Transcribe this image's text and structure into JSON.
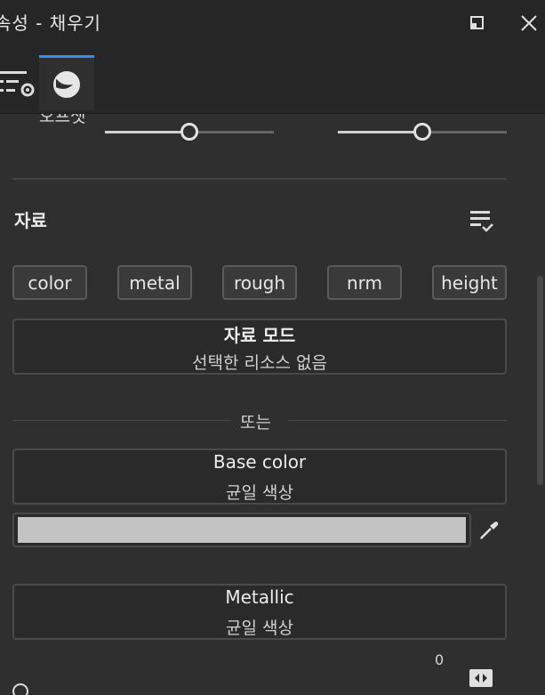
{
  "window": {
    "title": "속성 - 채우기"
  },
  "tabs": [
    {
      "icon": "settings-list-icon",
      "active": false
    },
    {
      "icon": "material-sphere-icon",
      "active": true
    }
  ],
  "panel": {
    "partial_label": "오프셋",
    "sliders": [
      {
        "value_fraction": 0.49
      },
      {
        "value_fraction": 0.49
      }
    ],
    "section": {
      "title": "자료",
      "menu_icon": "list-check-icon"
    },
    "channels": [
      "color",
      "metal",
      "rough",
      "nrm",
      "height"
    ],
    "material_mode": {
      "title": "자료 모드",
      "subtitle": "선택한 리소스 없음"
    },
    "or_label": "또는",
    "base_color": {
      "title": "Base color",
      "mode": "균일 색상",
      "swatch": "#c3c3c3",
      "picker_icon": "eyedropper-icon"
    },
    "metallic": {
      "title": "Metallic",
      "mode": "균일 색상",
      "value": "0",
      "link_icon": "link-arrows-icon"
    }
  },
  "colors": {
    "accent": "#3a8ee8",
    "background": "#2f2f2f",
    "chrome": "#262626"
  }
}
